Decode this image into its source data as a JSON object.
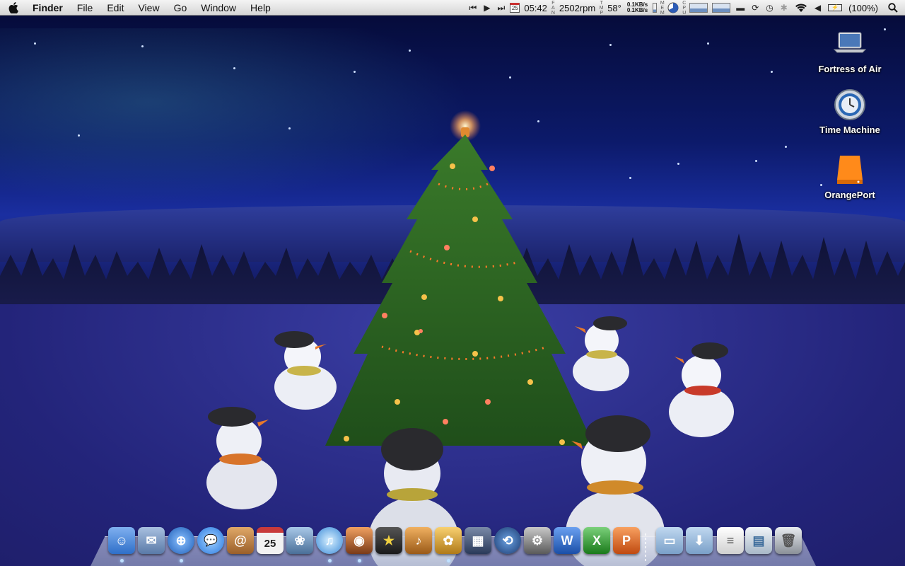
{
  "menubar": {
    "app_name": "Finder",
    "menus": [
      "File",
      "Edit",
      "View",
      "Go",
      "Window",
      "Help"
    ],
    "status": {
      "calendar_day": "25",
      "time": "05:42",
      "fan_label": "FAN",
      "fan_speed": "2502rpm",
      "temp_label": "TMP",
      "temperature": "58°",
      "net_up": "0.1KB/s",
      "net_down": "0.1KB/s",
      "mem_label": "MEM",
      "cpu_label": "CPU",
      "battery": "(100%)"
    }
  },
  "desktop_icons": [
    {
      "label": "Fortress of Air",
      "icon": "laptop-icon"
    },
    {
      "label": "Time Machine",
      "icon": "time-machine-icon"
    },
    {
      "label": "OrangePort",
      "icon": "external-drive-icon"
    }
  ],
  "dock": {
    "items": [
      {
        "name": "finder",
        "color": "#4f8fe0",
        "glyph": "☺"
      },
      {
        "name": "mail",
        "color": "#7a9ac8",
        "glyph": "✉"
      },
      {
        "name": "safari",
        "color": "#2f7fd6",
        "glyph": "⊕"
      },
      {
        "name": "ichat",
        "color": "#3a8ff0",
        "glyph": "💬"
      },
      {
        "name": "address-book",
        "color": "#c0864a",
        "glyph": "@"
      },
      {
        "name": "ical",
        "color": "#e8e8e8",
        "glyph": "25"
      },
      {
        "name": "iphoto",
        "color": "#6b8fb0",
        "glyph": "❀"
      },
      {
        "name": "itunes",
        "color": "#4aa0e0",
        "glyph": "♫"
      },
      {
        "name": "photo-booth",
        "color": "#b05a30",
        "glyph": "◉"
      },
      {
        "name": "imovie",
        "color": "#3a3a3a",
        "glyph": "★"
      },
      {
        "name": "garageband",
        "color": "#c07a2a",
        "glyph": "♪"
      },
      {
        "name": "adium",
        "color": "#d8a030",
        "glyph": "✿"
      },
      {
        "name": "dashboard",
        "color": "#4a5a7a",
        "glyph": "▦"
      },
      {
        "name": "time-machine",
        "color": "#2a5a9a",
        "glyph": "⟲"
      },
      {
        "name": "system-preferences",
        "color": "#8a8a8a",
        "glyph": "⚙"
      },
      {
        "name": "word",
        "color": "#2f6fc8",
        "glyph": "W"
      },
      {
        "name": "excel",
        "color": "#3a9a3a",
        "glyph": "X"
      },
      {
        "name": "powerpoint",
        "color": "#e07020",
        "glyph": "P"
      }
    ],
    "folders": [
      {
        "name": "documents-folder",
        "color": "#8fb4dc"
      },
      {
        "name": "downloads-folder",
        "color": "#8fb4dc"
      },
      {
        "name": "document-stack",
        "color": "#e8e8e8"
      },
      {
        "name": "image-stack",
        "color": "#d8e0ea"
      },
      {
        "name": "trash",
        "color": "#c8ccd2"
      }
    ]
  }
}
